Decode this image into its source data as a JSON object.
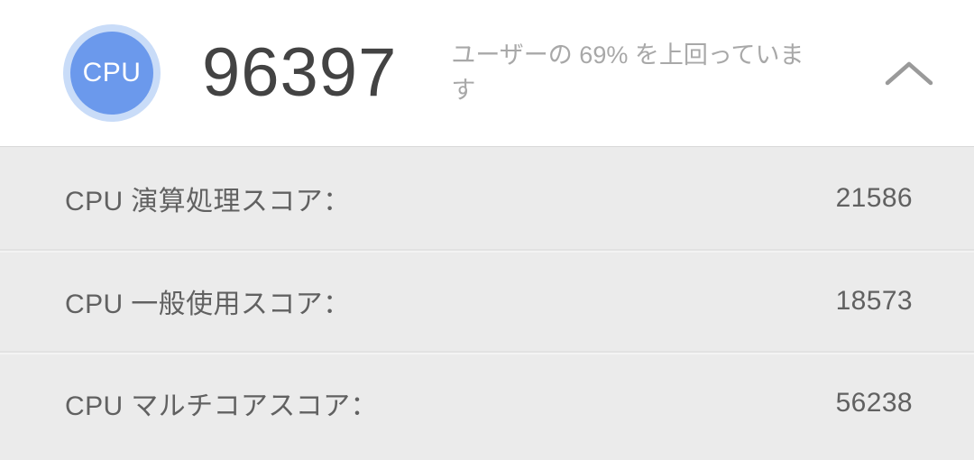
{
  "header": {
    "badge_label": "CPU",
    "badge_color": "#6b99ec",
    "badge_ring_color": "#c9dcf8",
    "score": "96397",
    "score_color": "#434343",
    "description": "ユーザーの 69% を上回っています",
    "percentile": "69%",
    "collapse_icon": "chevron-up-icon"
  },
  "scores": {
    "rows": [
      {
        "label": "CPU 演算処理スコア：",
        "value": "21586"
      },
      {
        "label": "CPU 一般使用スコア：",
        "value": "18573"
      },
      {
        "label": "CPU マルチコアスコア：",
        "value": "56238"
      }
    ]
  }
}
